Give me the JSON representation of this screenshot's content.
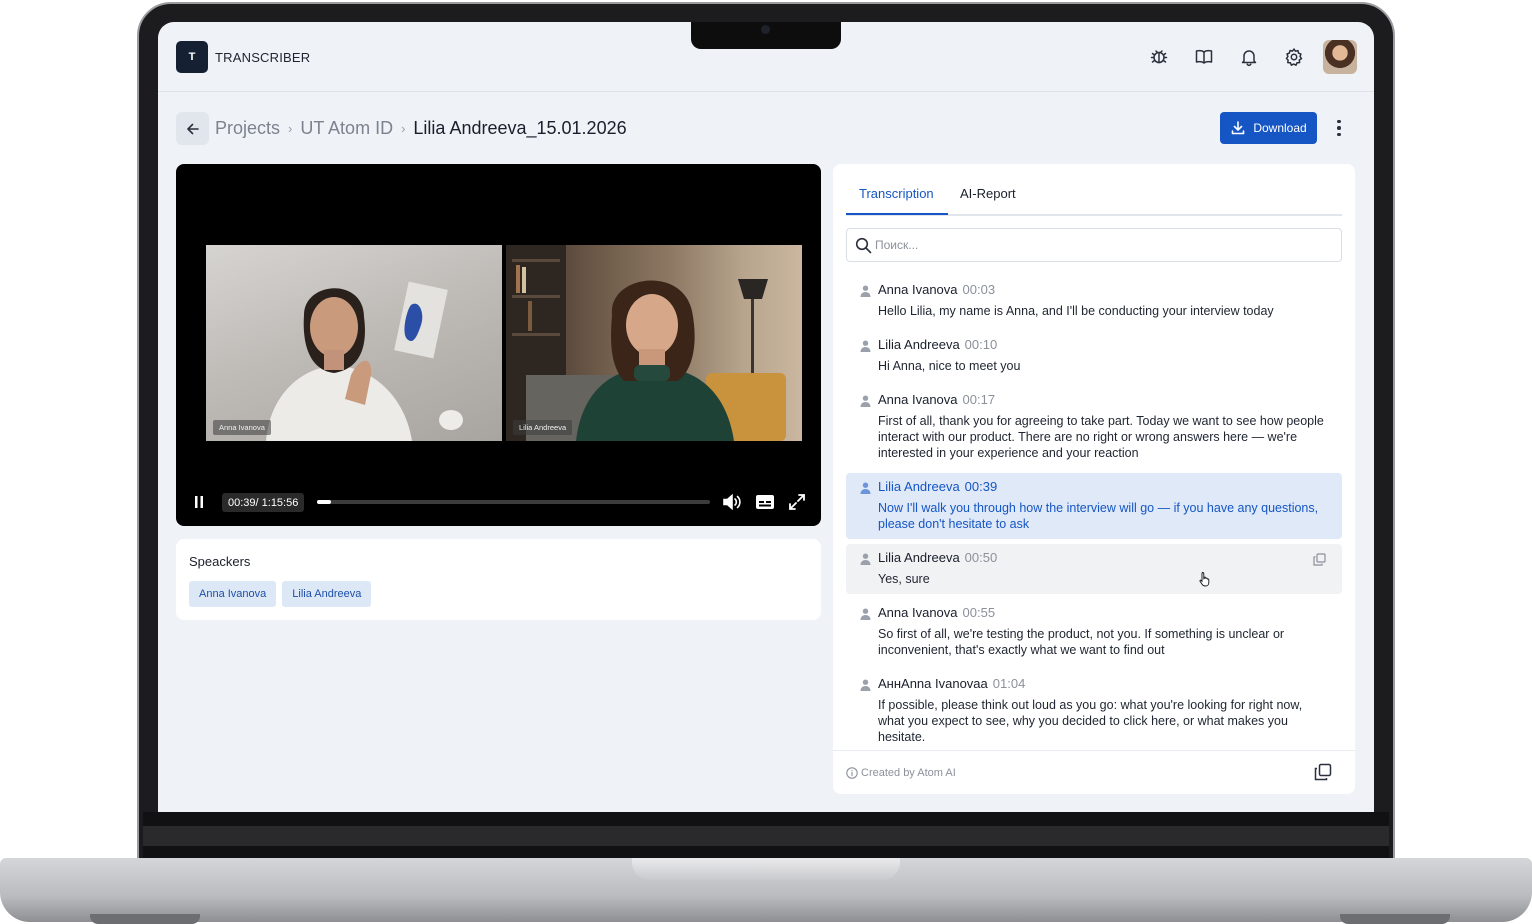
{
  "app": {
    "logo_letter": "T",
    "name": "TRANSCRIBER"
  },
  "header_icons": [
    "bug-icon",
    "book-icon",
    "bell-icon",
    "gear-icon",
    "avatar"
  ],
  "breadcrumb": {
    "items": [
      "Projects",
      "UT Atom ID"
    ],
    "current": "Lilia Andreeva_15.01.2026"
  },
  "actions": {
    "download_label": "Download"
  },
  "video": {
    "participants": [
      "Anna Ivanova",
      "Lilia Andreeva"
    ],
    "time": "00:39/ 1:15:56",
    "progress": 0.035
  },
  "speakers": {
    "title": "Speackers",
    "chips": [
      "Anna Ivanova",
      "Lilia Andreeva"
    ]
  },
  "tabs": [
    "Transcription",
    "AI-Report"
  ],
  "search": {
    "placeholder": "Поиск..."
  },
  "transcript": [
    {
      "speaker": "Anna Ivanova",
      "time": "00:03",
      "text": "Hello Lilia, my name is Anna, and I'll be conducting your interview today"
    },
    {
      "speaker": "Lilia Andreeva",
      "time": "00:10",
      "text": "Hi Anna, nice to meet you"
    },
    {
      "speaker": "Anna Ivanova",
      "time": "00:17",
      "text": "First of all, thank you for agreeing to take part. Today we want to see how people interact with our product. There are no right or wrong answers here — we're interested in your experience and your reaction"
    },
    {
      "speaker": "Lilia Andreeva",
      "time": "00:39",
      "text": "Now I'll walk you through how the interview will go — if you have any questions, please don't hesitate to ask"
    },
    {
      "speaker": "Lilia Andreeva",
      "time": "00:50",
      "text": "Yes, sure"
    },
    {
      "speaker": "Anna Ivanova",
      "time": "00:55",
      "text": "So first of all, we're testing the product, not you. If something is unclear or inconvenient, that's exactly what we want to find out"
    },
    {
      "speaker": "АннAnna Ivanovaa",
      "time": "01:04",
      "text": "If possible, please think out loud as you go: what you're looking for right now, what you expect to see, why you decided to click here, or what makes you hesitate."
    }
  ],
  "footer": {
    "credit": "Created by Atom AI"
  },
  "colors": {
    "accent": "#1656c4",
    "active_row": "#dfe9f8",
    "chip_bg": "#dde8f7"
  }
}
